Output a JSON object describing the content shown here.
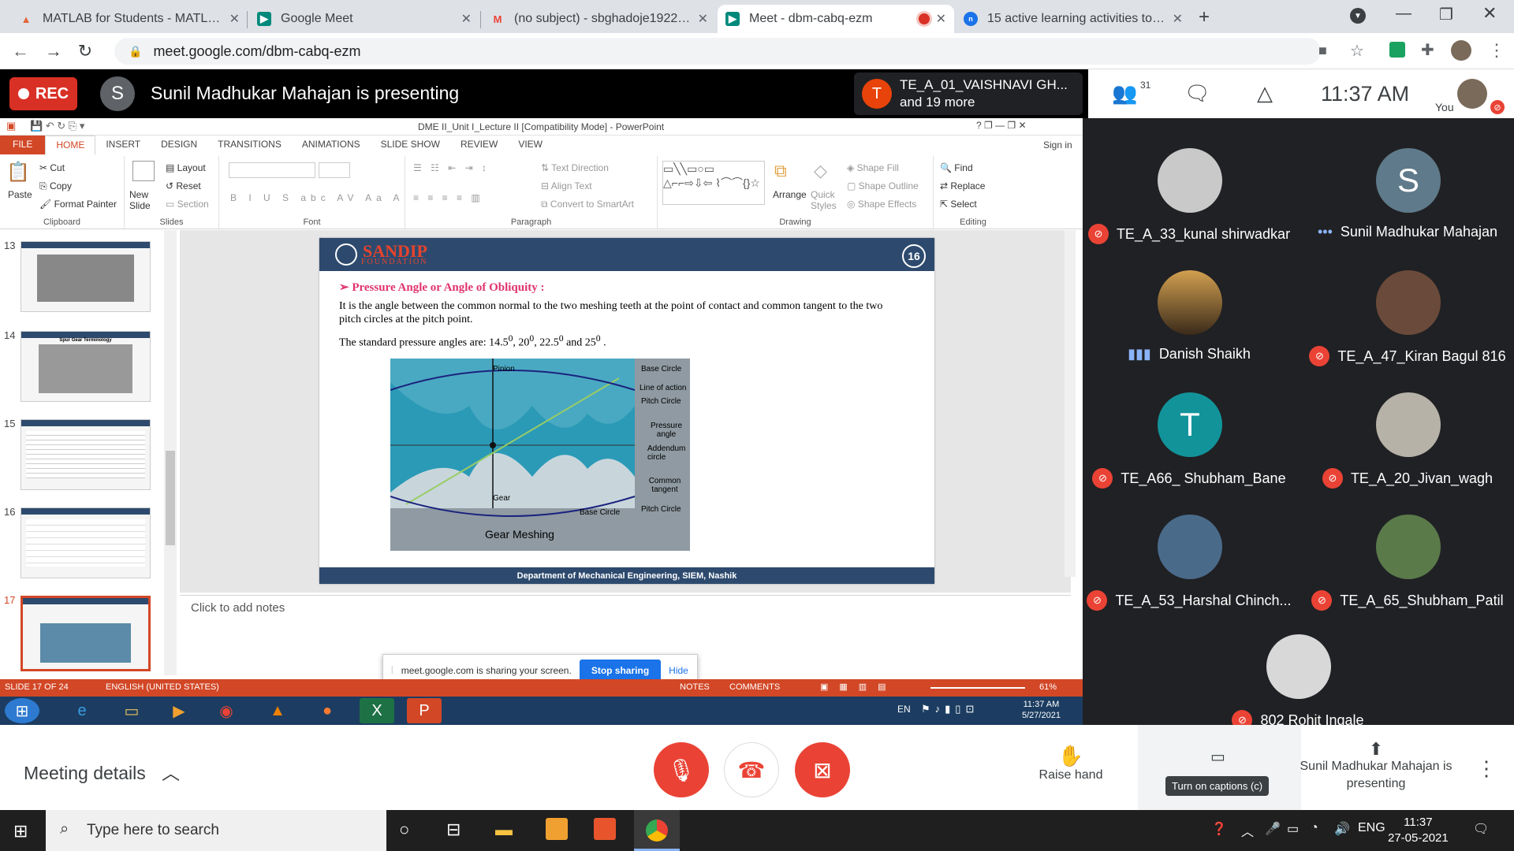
{
  "browser": {
    "tabs": [
      {
        "title": "MATLAB for Students - MATLAB & ",
        "favicon": "matlab-icon",
        "color": "#e16737"
      },
      {
        "title": "Google Meet",
        "favicon": "meet-icon",
        "color": "#00897b"
      },
      {
        "title": "(no subject) - sbghadoje1922192",
        "favicon": "gmail-icon",
        "color": "#ea4335"
      },
      {
        "title": "Meet - dbm-cabq-ezm",
        "favicon": "meet-icon",
        "color": "#00897b",
        "active": true
      },
      {
        "title": "15 active learning activities to en",
        "favicon": "web-icon",
        "color": "#1a73e8"
      }
    ],
    "url": "meet.google.com/dbm-cabq-ezm"
  },
  "meet": {
    "rec_label": "REC",
    "presenter_initial": "S",
    "presenting_text": "Sunil Madhukar Mahajan is presenting",
    "join_notice": {
      "initial": "T",
      "line1": "TE_A_01_VAISHNAVI GH...",
      "line2": "and 19 more"
    },
    "participant_count": "31",
    "time": "11:37 AM",
    "you_label": "You",
    "participants": [
      {
        "name": "TE_A_33_kunal shirwadkar",
        "muted": true,
        "avatar": "photo",
        "color": "#c9c9c9"
      },
      {
        "name": "Sunil Madhukar Mahajan",
        "muted": false,
        "speaking_dots": true,
        "avatar": "S",
        "color": "#5f7a8a"
      },
      {
        "name": "Danish Shaikh",
        "muted": false,
        "speaking": true,
        "avatar": "photo",
        "color": "#8a5a2a"
      },
      {
        "name": "TE_A_47_Kiran Bagul 816",
        "muted": true,
        "avatar": "photo",
        "color": "#6a4a3a"
      },
      {
        "name": "TE_A66_ Shubham_Bane",
        "muted": true,
        "avatar": "T",
        "color": "#12939a"
      },
      {
        "name": "TE_A_20_Jivan_wagh",
        "muted": true,
        "avatar": "photo",
        "color": "#b6b2a8"
      },
      {
        "name": "TE_A_53_Harshal Chinch...",
        "muted": true,
        "avatar": "photo",
        "color": "#4a6a8a"
      },
      {
        "name": "TE_A_65_Shubham_Patil",
        "muted": true,
        "avatar": "photo",
        "color": "#5a7a4a"
      },
      {
        "name": "802 Rohit Ingale",
        "muted": true,
        "avatar": "photo",
        "color": "#d8d8d8"
      }
    ],
    "meeting_details": "Meeting details",
    "raise_hand": "Raise hand",
    "captions_tooltip": "Turn on captions (c)",
    "presenting_button": "Sunil Madhukar Mahajan is presenting",
    "share_bar": {
      "text": "meet.google.com is sharing your screen.",
      "stop": "Stop sharing",
      "hide": "Hide"
    }
  },
  "ppt": {
    "title": "DME II_Unit I_Lecture II [Compatibility Mode] - PowerPoint",
    "ribbon_tabs": [
      "FILE",
      "HOME",
      "INSERT",
      "DESIGN",
      "TRANSITIONS",
      "ANIMATIONS",
      "SLIDE SHOW",
      "REVIEW",
      "VIEW"
    ],
    "sign_in": "Sign in",
    "groups": {
      "clipboard": {
        "label": "Clipboard",
        "paste": "Paste",
        "cut": "Cut",
        "copy": "Copy",
        "format_painter": "Format Painter"
      },
      "slides": {
        "label": "Slides",
        "new_slide": "New Slide",
        "layout": "Layout",
        "reset": "Reset",
        "section": "Section"
      },
      "font": {
        "label": "Font"
      },
      "paragraph": {
        "label": "Paragraph",
        "text_direction": "Text Direction",
        "align_text": "Align Text",
        "smartart": "Convert to SmartArt"
      },
      "drawing": {
        "label": "Drawing",
        "arrange": "Arrange",
        "quick_styles": "Quick Styles",
        "shape_fill": "Shape Fill",
        "shape_outline": "Shape Outline",
        "shape_effects": "Shape Effects"
      },
      "editing": {
        "label": "Editing",
        "find": "Find",
        "replace": "Replace",
        "select": "Select"
      }
    },
    "thumb_numbers": [
      "13",
      "14",
      "15",
      "16",
      "17"
    ],
    "thumb14_title": "Spur Gear Terminology",
    "slide": {
      "logo": "SANDIP",
      "logo_sub": "FOUNDATION",
      "number": "16",
      "heading": "Pressure Angle or Angle of Obliquity :",
      "para": "It is the angle between the common normal to the two meshing teeth at the point of contact and common tangent to the two pitch circles at the pitch point.",
      "std_prefix": "The standard pressure angles are: 14.5",
      "std_mid1": ", 20",
      "std_mid2": ", 22.5",
      "std_mid3": " and 25",
      "std_end": " .",
      "deg": "0",
      "image_labels": {
        "pinion": "Pinion",
        "base_circle": "Base Circle",
        "line_of_action": "Line of action",
        "pitch_circle": "Pitch Circle",
        "pressure_angle": "Pressure angle",
        "addendum": "Addendum circle",
        "common_tangent": "Common tangent",
        "gear": "Gear",
        "base_circle2": "Base Circle",
        "pitch_circle2": "Pitch Circle",
        "caption": "Gear Meshing"
      },
      "footer": "Department of Mechanical Engineering, SIEM, Nashik"
    },
    "notes_placeholder": "Click to add notes",
    "status": {
      "slide": "SLIDE 17 OF 24",
      "lang": "ENGLISH (UNITED STATES)",
      "notes": "NOTES",
      "comments": "COMMENTS",
      "zoom": "61%"
    },
    "win_tray": {
      "lang": "EN",
      "time": "11:37 AM",
      "date": "5/27/2021"
    }
  },
  "taskbar": {
    "search_placeholder": "Type here to search",
    "lang": "ENG",
    "time": "11:37",
    "date": "27-05-2021"
  }
}
